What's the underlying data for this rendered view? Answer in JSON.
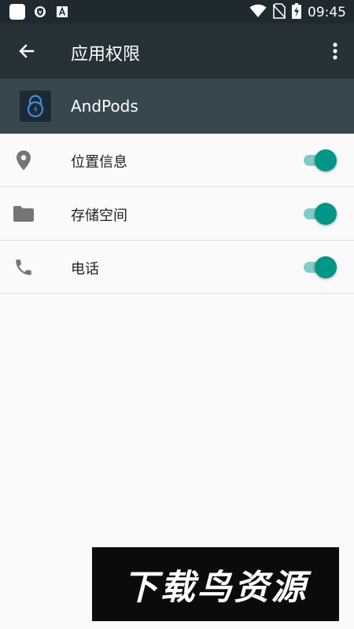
{
  "status_bar": {
    "time": "09:45",
    "icons": [
      "notification-square-icon",
      "shield-icon",
      "font-a-icon",
      "wifi-icon",
      "no-sim-icon",
      "battery-charging-icon"
    ]
  },
  "toolbar": {
    "title": "应用权限",
    "back_icon": "arrow-left-icon",
    "more_icon": "more-vert-icon"
  },
  "app_header": {
    "app_name": "AndPods"
  },
  "permissions": [
    {
      "label": "位置信息",
      "icon": "location-pin-icon",
      "enabled": true
    },
    {
      "label": "存储空间",
      "icon": "folder-icon",
      "enabled": true
    },
    {
      "label": "电话",
      "icon": "phone-icon",
      "enabled": true
    }
  ],
  "watermark": {
    "text": "下载鸟资源"
  },
  "colors": {
    "status_bar": "#1f2a30",
    "toolbar": "#263238",
    "app_header": "#37474f",
    "accent": "#009688",
    "accent_track": "#80cbc4",
    "icon_gray": "#757575"
  }
}
